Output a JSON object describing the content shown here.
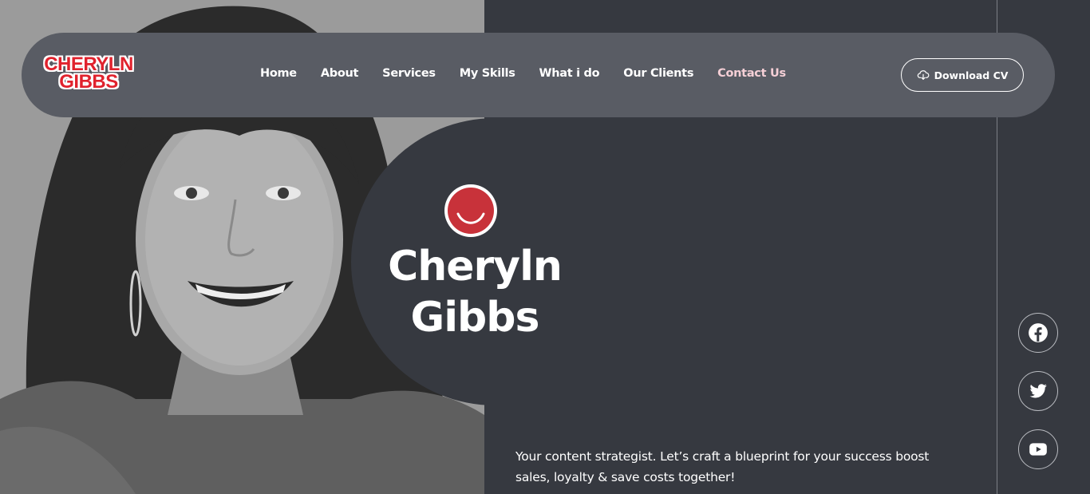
{
  "header": {
    "logo": {
      "line1": "CHERYLN",
      "line2": "GIBBS"
    },
    "nav": [
      {
        "label": "Home"
      },
      {
        "label": "About"
      },
      {
        "label": "Services"
      },
      {
        "label": "My Skills"
      },
      {
        "label": "What i do"
      },
      {
        "label": "Our Clients"
      },
      {
        "label": "Contact Us",
        "active": true
      }
    ],
    "download_cv": {
      "label": "Download CV",
      "icon": "cloud-download-icon"
    }
  },
  "hero": {
    "name_line1": "Cheryln",
    "name_line2": "Gibbs",
    "tagline": "Your content strategist. Let’s craft a blueprint for your success boost sales, loyalty & save costs together!"
  },
  "social": [
    {
      "name": "facebook",
      "icon": "facebook-icon"
    },
    {
      "name": "twitter",
      "icon": "twitter-icon"
    },
    {
      "name": "youtube",
      "icon": "youtube-icon"
    }
  ],
  "colors": {
    "background": "#363940",
    "header": "#595c64",
    "accent_red": "#c8323a",
    "active_nav": "#f5cfd6"
  }
}
